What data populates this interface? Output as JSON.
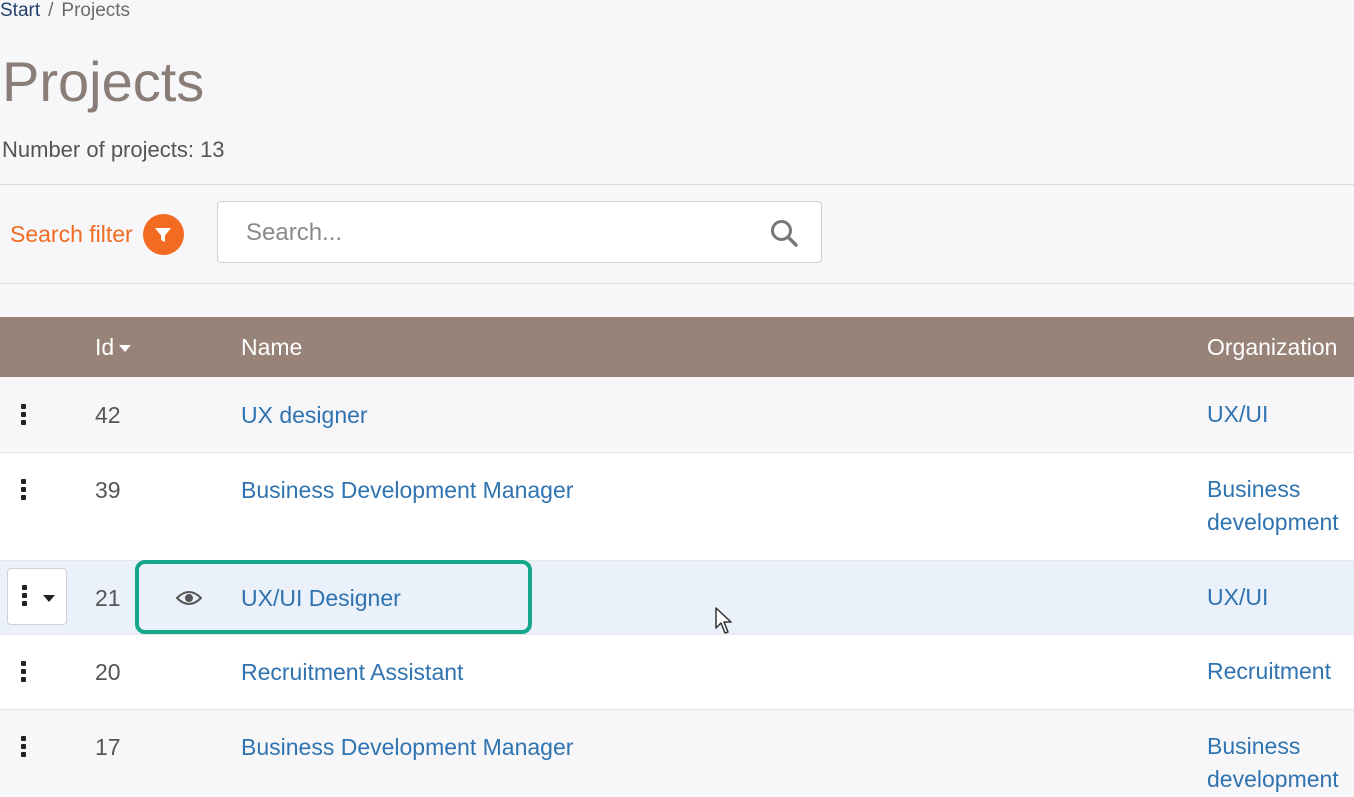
{
  "breadcrumb": {
    "start": "Start",
    "separator": "/",
    "current": "Projects"
  },
  "page": {
    "title": "Projects",
    "count_text": "Number of projects: 13"
  },
  "filter": {
    "label": "Search filter",
    "icon": "filter-icon",
    "accent_color": "#f26b21"
  },
  "search": {
    "placeholder": "Search...",
    "value": "",
    "icon": "search-icon"
  },
  "table": {
    "header_color": "#978378",
    "columns": {
      "id": "Id",
      "name": "Name",
      "organization": "Organization"
    },
    "sort": {
      "column": "Id",
      "direction": "descending"
    },
    "rows": [
      {
        "id": "42",
        "name": "UX designer",
        "organization": "UX/UI",
        "org_lines": [
          "UX/UI"
        ]
      },
      {
        "id": "39",
        "name": "Business Development Manager",
        "organization": "Business development",
        "org_lines": [
          "Business",
          "development"
        ]
      },
      {
        "id": "21",
        "name": "UX/UI Designer",
        "organization": "UX/UI",
        "org_lines": [
          "UX/UI"
        ],
        "hovered": true
      },
      {
        "id": "20",
        "name": "Recruitment Assistant",
        "organization": "Recruitment",
        "org_lines": [
          "Recruitment"
        ]
      },
      {
        "id": "17",
        "name": "Business Development Manager",
        "organization": "Business development",
        "org_lines": [
          "Business",
          "development"
        ]
      }
    ]
  },
  "colors": {
    "link": "#2f73b0",
    "title": "#8a7d77",
    "highlight": "#16a68a",
    "hover_row": "#eaf1fb"
  }
}
